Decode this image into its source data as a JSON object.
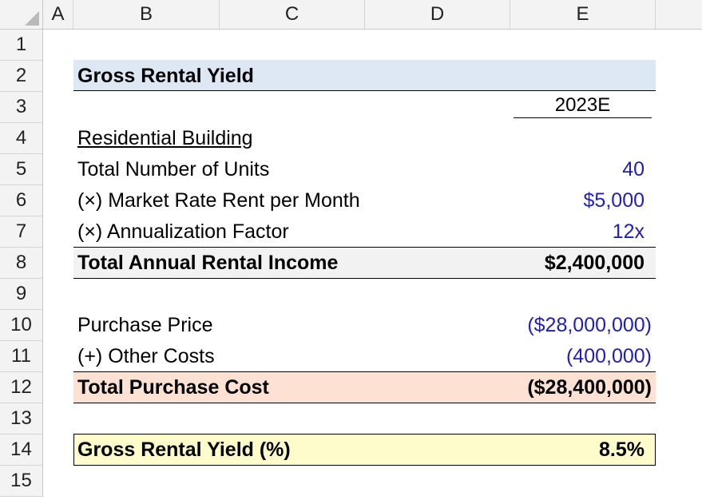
{
  "columns": [
    "A",
    "B",
    "C",
    "D",
    "E"
  ],
  "rows": [
    "1",
    "2",
    "3",
    "4",
    "5",
    "6",
    "7",
    "8",
    "9",
    "10",
    "11",
    "12",
    "13",
    "14",
    "15"
  ],
  "title": "Gross Rental Yield",
  "year_label": "2023E",
  "section_label": "Residential Building",
  "items": {
    "units": {
      "label": "Total Number of Units",
      "value": "40"
    },
    "rent": {
      "label": "(×) Market Rate Rent per Month",
      "value": "$5,000"
    },
    "factor": {
      "label": "(×) Annualization Factor",
      "value": "12x"
    },
    "income": {
      "label": "Total Annual Rental Income",
      "value": "$2,400,000"
    },
    "price": {
      "label": "Purchase Price",
      "value": "($28,000,000)"
    },
    "other": {
      "label": "(+) Other Costs",
      "value": "(400,000)"
    },
    "cost": {
      "label": "Total Purchase Cost",
      "value": "($28,400,000)"
    },
    "yield": {
      "label": "Gross Rental Yield (%)",
      "value": "8.5%"
    }
  },
  "colors": {
    "input_blue": "#1f1fb4",
    "title_band": "#dde8f4",
    "total_band": "#f2f2f2",
    "cost_band": "#fde1d3",
    "yield_band": "#fefccb"
  }
}
